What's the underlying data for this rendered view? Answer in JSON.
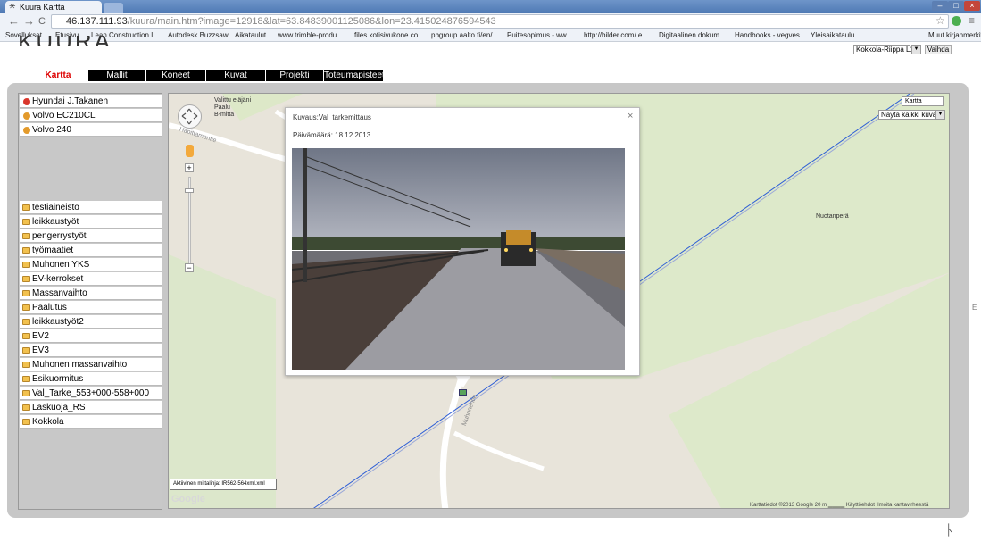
{
  "browser": {
    "tab_title": "Kuura Kartta",
    "url_host": "46.137.111.93",
    "url_path": "/kuura/main.htm?image=12918&lat=63.84839001125086&lon=23.415024876594543"
  },
  "bookmarks": [
    "Sovellukset",
    "Etusivu",
    "Lean Construction I...",
    "Autodesk Buzzsaw",
    "Aikataulut",
    "www.trimble-produ...",
    "files.kotisivukone.co...",
    "pbgroup.aalto.fi/en/...",
    "Puitesopimus - ww...",
    "http://bilder.com/ e...",
    "Digitaalinen dokum...",
    "Handbooks - vegves...",
    "Yleisaikataulu",
    "Muut kirjanmerkit"
  ],
  "app": {
    "logo": "KUURA",
    "project_select": "Kokkola-Riippa L1",
    "switch_button": "Vaihda",
    "tabs": [
      "Kartta",
      "Mallit",
      "Koneet",
      "Kuvat",
      "Projekti",
      "Toteumapisteet"
    ]
  },
  "machines": [
    {
      "label": "Hyundai J.Takanen",
      "color": "#d9362b"
    },
    {
      "label": "Volvo EC210CL",
      "color": "#e39a2b"
    },
    {
      "label": "Volvo 240",
      "color": "#e39a2b"
    }
  ],
  "folders": [
    "testiaineisto",
    "leikkaustyöt",
    "pengerrystyöt",
    "työmaatiet",
    "Muhonen YKS",
    "EV-kerrokset",
    "Massanvaihto",
    "Paalutus",
    "leikkaustyöt2",
    "EV2",
    "EV3",
    "Muhonen massanvaihto",
    "Esikuormitus",
    "Val_Tarke_553+000-558+000",
    "Laskuoja_RS",
    "Kokkola"
  ],
  "map": {
    "map_type": "Kartta",
    "show_images": "Näytä kaikki kuvat",
    "layer_legend": [
      "Valittu eläjäni",
      "Paalu",
      "B-mitta"
    ],
    "place_label": "Nuotanperä",
    "road_label_1": "Hapittamontie",
    "road_label_2": "Muhonentie",
    "measure_line": "Aktiivinen mittalinja: IR562-564xml.xml",
    "google": "Google",
    "attribution": "Karttatiedot ©2013 Google   20 m ▁▁▁▁   Käyttöehdot   Ilmoita karttavirheestä"
  },
  "popup": {
    "title": "Kuvaus:Val_tarkemittaus",
    "date": "Päivämäärä: 18.12.2013",
    "close": "×"
  }
}
